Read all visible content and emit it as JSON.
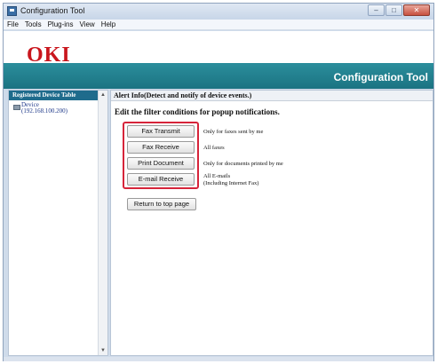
{
  "window": {
    "title": "Configuration Tool",
    "controls": {
      "minimize": "–",
      "maximize": "□",
      "close": "✕"
    }
  },
  "menu": [
    "File",
    "Tools",
    "Plug-ins",
    "View",
    "Help"
  ],
  "banner": {
    "logo": "OKI",
    "title": "Configuration Tool",
    "brand_color": "#c9161d",
    "bar_color": "#1b7382"
  },
  "sidebar": {
    "header": "Registered Device Table",
    "device": {
      "name": "Device",
      "address": "(192.168.100.200)"
    },
    "scroll_up": "▲",
    "scroll_down": "▼"
  },
  "main": {
    "section_title": "Alert Info(Detect and notify of device events.)",
    "instruction": "Edit the filter conditions for popup notifications.",
    "options": [
      {
        "label": "Fax Transmit",
        "description": "Only for faxes sent by me"
      },
      {
        "label": "Fax Receive",
        "description": "All faxes"
      },
      {
        "label": "Print Document",
        "description": "Only for documents printed by me"
      },
      {
        "label": "E-mail Receive",
        "description": "All E-mails",
        "description2": "(Including Internet Fax)"
      }
    ],
    "return_button": "Return to top page",
    "highlight_color": "#d6243a"
  }
}
